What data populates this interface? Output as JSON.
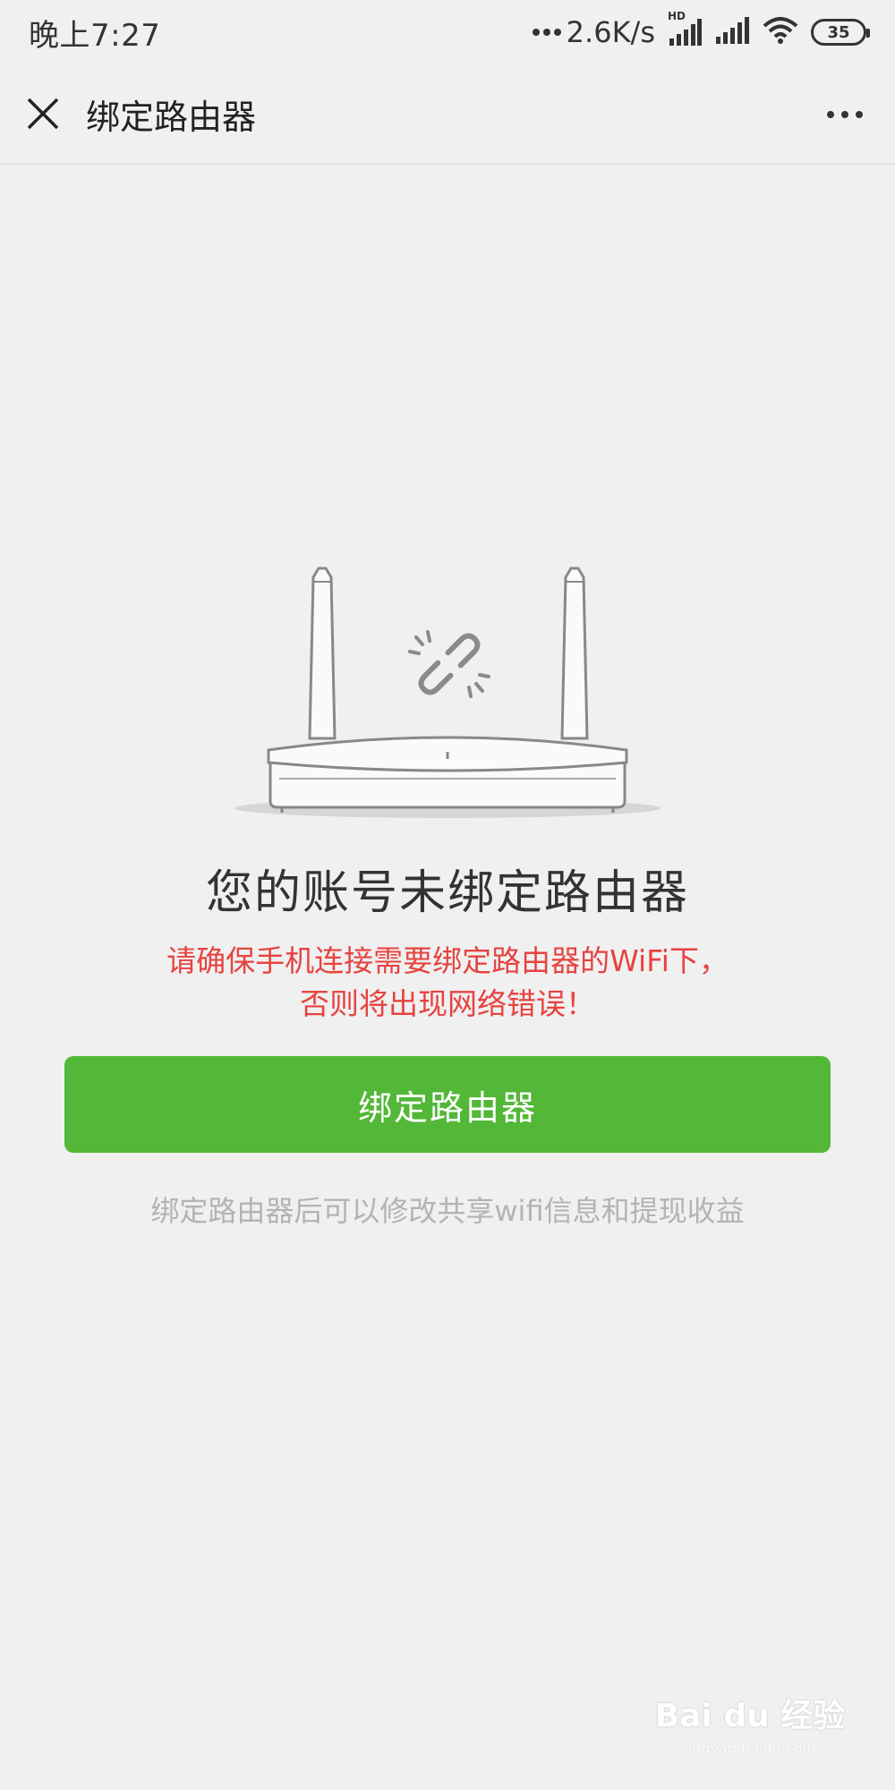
{
  "status_bar": {
    "time": "晚上7:27",
    "net_speed": "2.6K/s",
    "hd_label": "HD",
    "battery": "35",
    "icons": [
      "dots-icon",
      "signal-hd-icon",
      "signal-icon",
      "wifi-icon",
      "battery-icon"
    ]
  },
  "nav": {
    "title": "绑定路由器",
    "close_icon": "close-icon",
    "more_icon": "more-icon"
  },
  "main": {
    "illustration": "router-unlinked-illustration",
    "headline": "您的账号未绑定路由器",
    "warning_line1": "请确保手机连接需要绑定路由器的WiFi下，",
    "warning_line2": "否则将出现网络错误！",
    "bind_button": "绑定路由器",
    "hint": "绑定路由器后可以修改共享wifi信息和提现收益"
  },
  "watermark": {
    "main": "Bai du 经验",
    "sub": "jingyan.baidu.com"
  },
  "colors": {
    "accent_green": "#53b738",
    "warning_red": "#e64340",
    "hint_gray": "#b3b3b3",
    "background": "#f0f0f0"
  }
}
